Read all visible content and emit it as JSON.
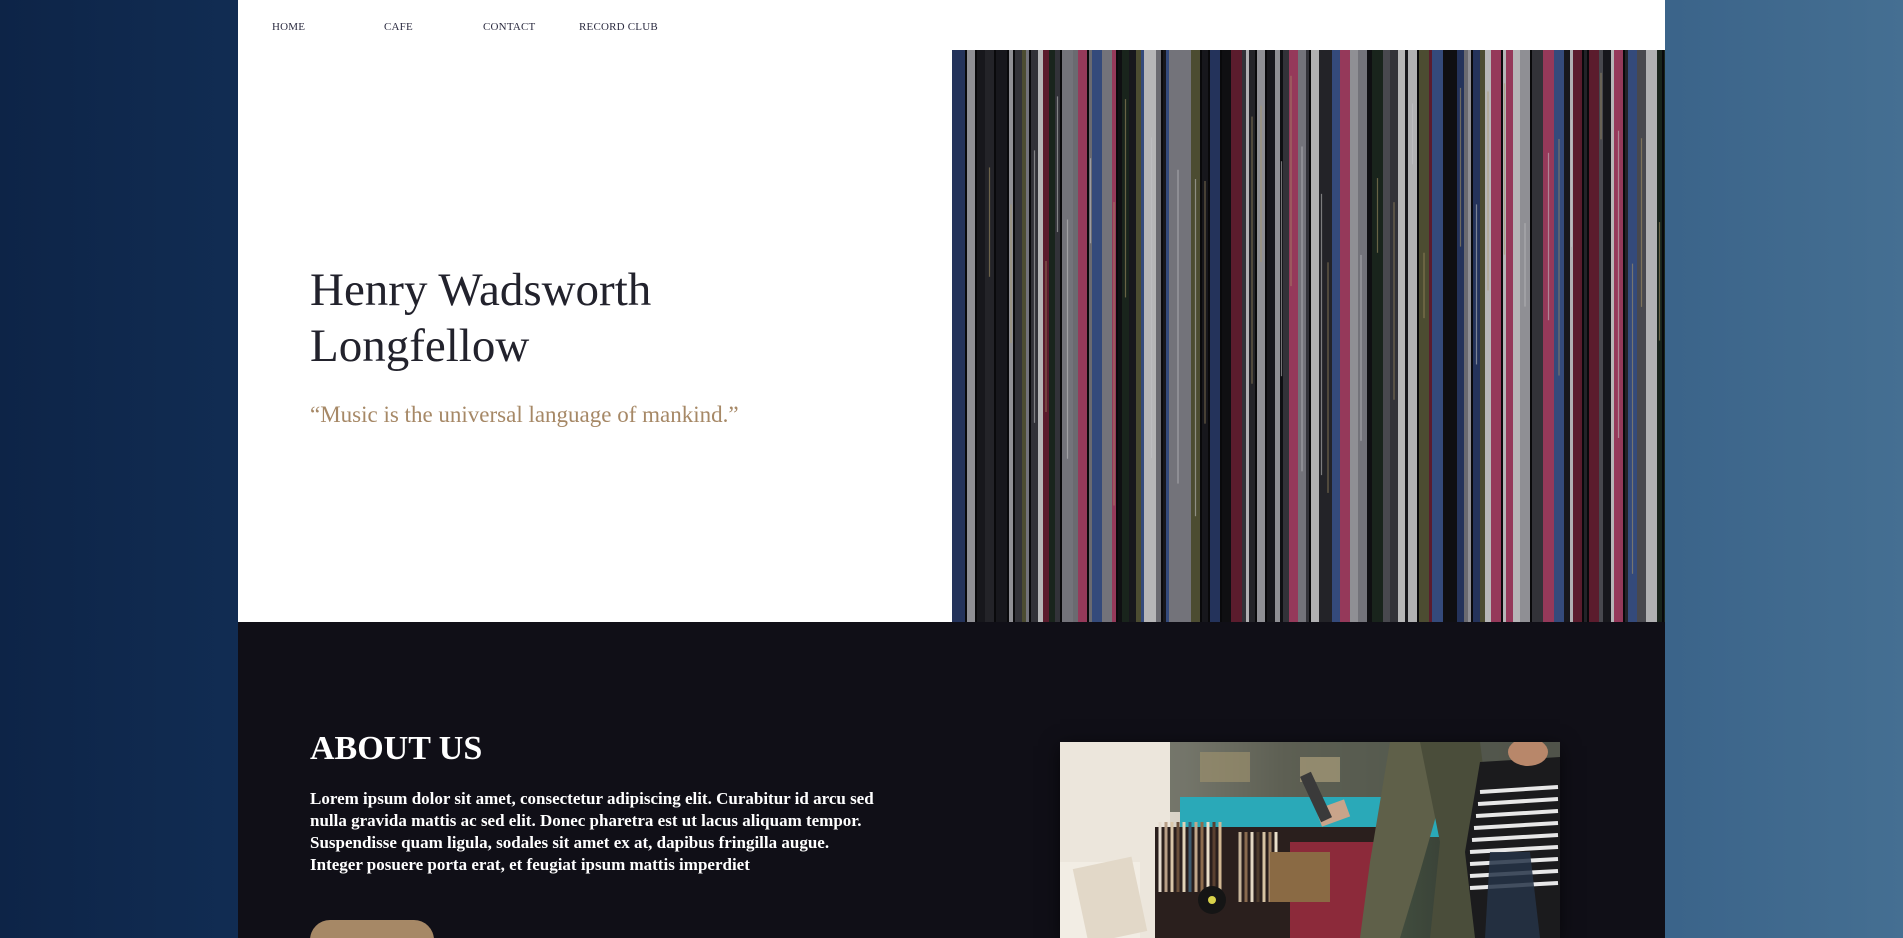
{
  "nav": {
    "items": [
      {
        "label": "HOME"
      },
      {
        "label": "CAFE"
      },
      {
        "label": "CONTACT"
      },
      {
        "label": "RECORD CLUB"
      }
    ]
  },
  "hero": {
    "title": "Henry Wadsworth Longfellow",
    "quote": "“Music is the universal language of mankind.”",
    "image_icon": "vinyl-records-photo"
  },
  "about": {
    "title": "ABOUT US",
    "body": "Lorem ipsum dolor sit amet, consectetur adipiscing elit. Curabitur id arcu sed nulla gravida mattis ac sed elit. Donec pharetra est ut lacus aliquam tempor. Suspendisse quam ligula, sodales sit amet ex at, dapibus fringilla augue. Integer posuere porta erat, et feugiat ipsum mattis imperdiet",
    "image_icon": "record-store-photo"
  },
  "colors": {
    "accent": "#a68866",
    "dark_section": "#100f17",
    "heading": "#22222c"
  }
}
